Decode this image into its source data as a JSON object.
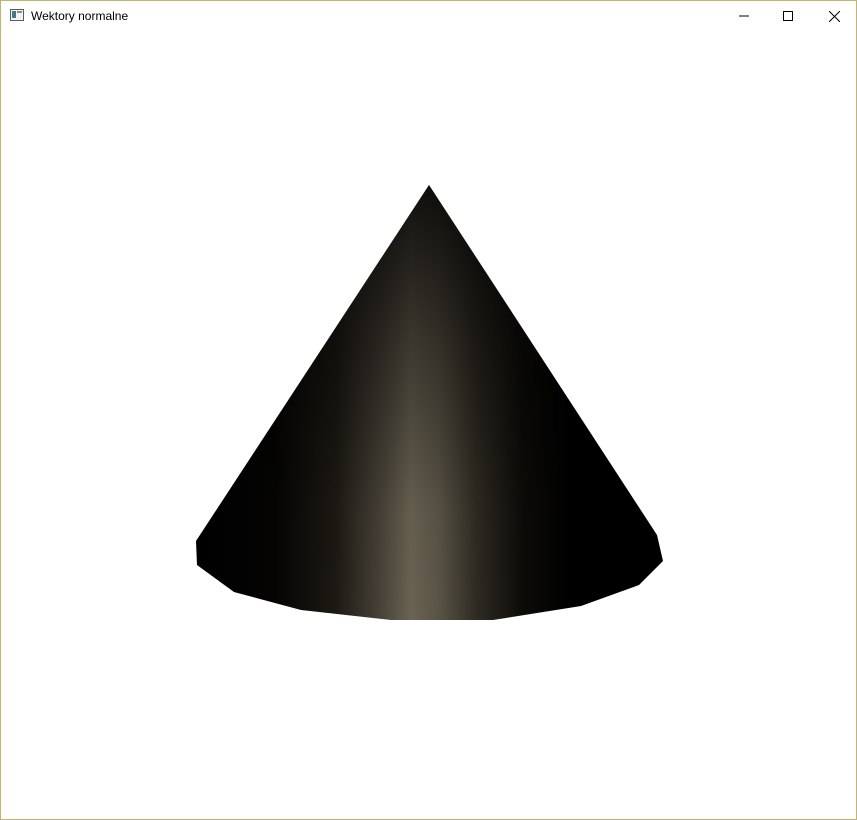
{
  "window": {
    "title": "Wektory normalne",
    "icon": "app-window-icon",
    "controls": [
      "minimize-icon",
      "maximize-icon",
      "close-icon"
    ]
  },
  "scene": {
    "object": "cone",
    "background_color": "#ffffff",
    "shadow_color": "#000000",
    "highlight_color": "#6f6757"
  }
}
